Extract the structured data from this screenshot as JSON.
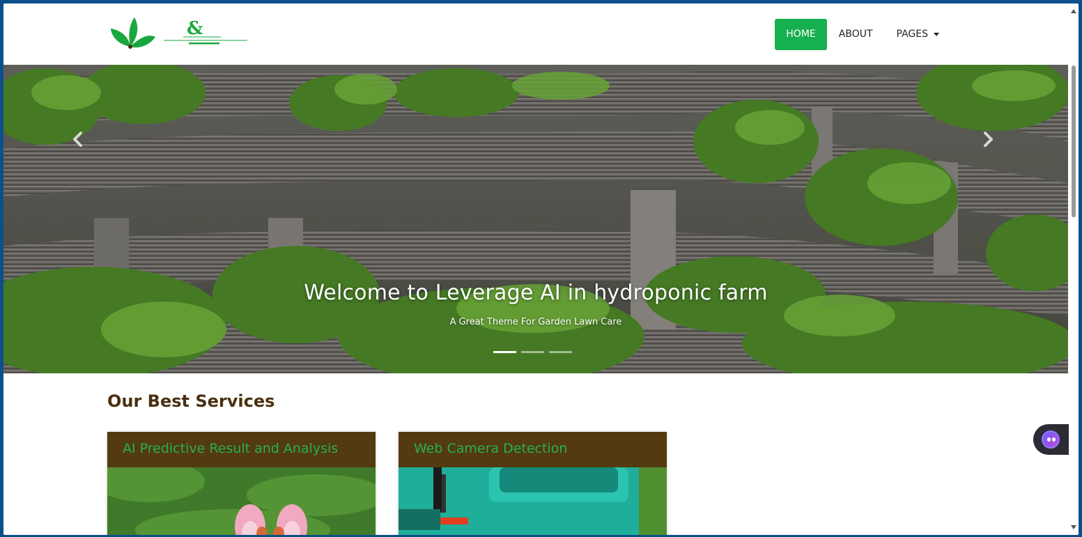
{
  "nav": {
    "items": [
      {
        "label": "HOME",
        "active": true
      },
      {
        "label": "ABOUT",
        "active": false
      },
      {
        "label": "PAGES",
        "active": false,
        "dropdown": true
      }
    ]
  },
  "hero": {
    "title": "Welcome to Leverage AI in hydroponic farm",
    "subtitle": "A Great Theme For Garden Lawn Care",
    "slides": 3,
    "active_slide": 1,
    "prev_icon": "chevron-left-icon",
    "next_icon": "chevron-right-icon"
  },
  "services": {
    "title": "Our Best Services",
    "cards": [
      {
        "title": "AI Predictive Result and Analysis"
      },
      {
        "title": "Web Camera Detection"
      }
    ]
  },
  "colors": {
    "accent": "#17b050",
    "card_header_bg": "#533a10",
    "card_header_text": "#25b24e",
    "section_title": "#4a3010",
    "window_border": "#0d4f8b"
  },
  "widget": {
    "icon": "chat-bot-icon"
  }
}
